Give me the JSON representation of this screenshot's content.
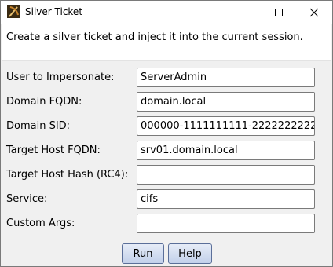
{
  "window": {
    "title": "Silver Ticket",
    "app_icon": "bow-arrow-icon",
    "controls": [
      "minimize-icon",
      "maximize-icon",
      "close-icon"
    ]
  },
  "description": "Create a silver ticket and inject it into the current session.",
  "form": {
    "user": {
      "label": "User to Impersonate:",
      "value": "ServerAdmin"
    },
    "domain_fqdn": {
      "label": "Domain FQDN:",
      "value": "domain.local"
    },
    "domain_sid": {
      "label": "Domain SID:",
      "value": "000000-1111111111-2222222222"
    },
    "target_host": {
      "label": "Target Host FQDN:",
      "value": "srv01.domain.local"
    },
    "target_hash": {
      "label": "Target Host Hash (RC4):",
      "value": ""
    },
    "service": {
      "label": "Service:",
      "value": "cifs"
    },
    "custom_args": {
      "label": "Custom Args:",
      "value": ""
    }
  },
  "buttons": {
    "run": "Run",
    "help": "Help"
  }
}
